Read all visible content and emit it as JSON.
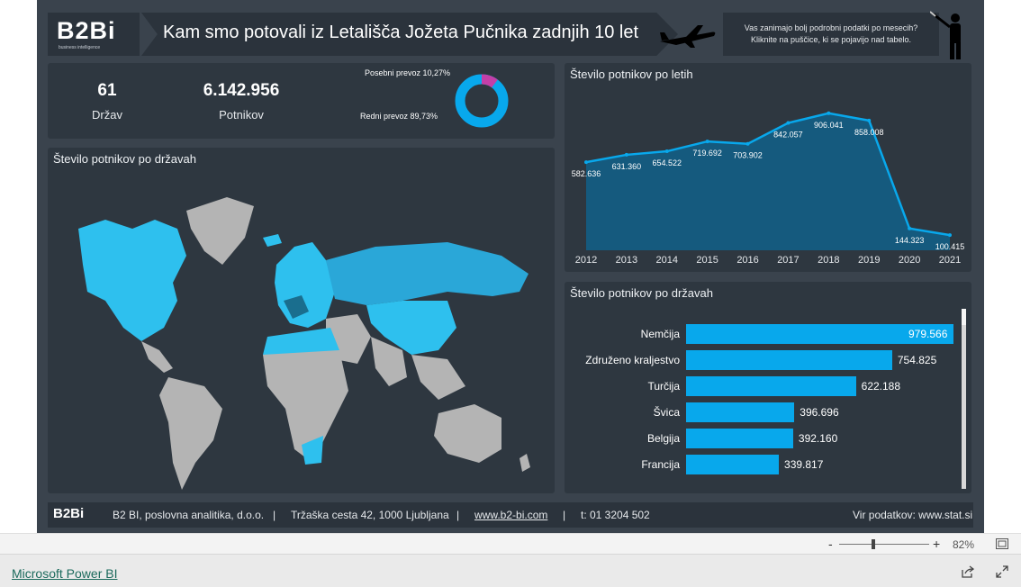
{
  "header": {
    "logo": "B2Bi",
    "logo_sub": "business intelligence",
    "title": "Kam smo potovali iz Letališča Jožeta Pučnika zadnjih 10 let",
    "info_line1": "Vas zanimajo bolj podrobni podatki po mesecih?",
    "info_line2": "Kliknite na puščice, ki se pojavijo nad tabelo."
  },
  "kpis": {
    "countries_value": "61",
    "countries_label": "Držav",
    "passengers_value": "6.142.956",
    "passengers_label": "Potnikov"
  },
  "donut": {
    "special_label": "Posebni prevoz 10,27%",
    "regular_label": "Redni prevoz 89,73%",
    "special_fraction": 0.1027,
    "colors": {
      "regular": "#08a8ec",
      "special": "#c43fa8"
    }
  },
  "map_panel": {
    "title": "Število potnikov po državah"
  },
  "chart_data": [
    {
      "type": "area",
      "title": "Število potnikov po letih",
      "categories": [
        "2012",
        "2013",
        "2014",
        "2015",
        "2016",
        "2017",
        "2018",
        "2019",
        "2020",
        "2021"
      ],
      "values": [
        582636,
        631360,
        654522,
        719692,
        703902,
        842057,
        906041,
        858008,
        144323,
        100415
      ],
      "data_labels": [
        "582.636",
        "631.360",
        "654.522",
        "719.692",
        "703.902",
        "842.057",
        "906.041",
        "858.008",
        "144.323",
        "100.415"
      ],
      "ylim": [
        0,
        1000000
      ],
      "grid": false,
      "colors": {
        "line": "#08a8ec",
        "fill": "#155a7e"
      }
    },
    {
      "type": "bar",
      "title": "Število potnikov po državah",
      "categories": [
        "Nemčija",
        "Združeno kraljestvo",
        "Turčija",
        "Švica",
        "Belgija",
        "Francija"
      ],
      "values": [
        979566,
        754825,
        622188,
        396696,
        392160,
        339817
      ],
      "data_labels": [
        "979.566",
        "754.825",
        "622.188",
        "396.696",
        "392.160",
        "339.817"
      ],
      "colors": {
        "bar": "#08a8ec"
      }
    }
  ],
  "footer": {
    "logo": "B2Bi",
    "company": "B2 BI, poslovna analitika, d.o.o.",
    "sep": "|",
    "address": "Tržaška cesta 42, 1000 Ljubljana",
    "website": "www.b2-bi.com",
    "phone": "t: 01 3204 502",
    "source": "Vir podatkov: www.stat.si"
  },
  "viewer": {
    "zoom_minus": "-",
    "zoom_plus": "+",
    "zoom_level": "82%",
    "powerbi_link": "Microsoft Power BI",
    "icons": [
      "fit-page-icon",
      "share-icon",
      "fullscreen-icon"
    ]
  }
}
